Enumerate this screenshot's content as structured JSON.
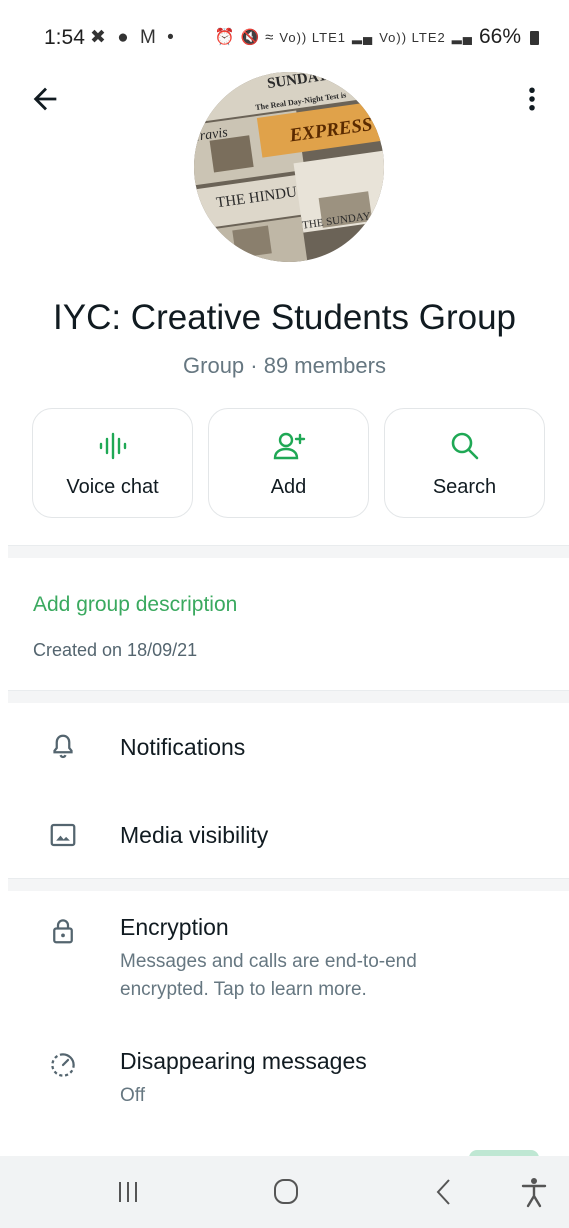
{
  "status_bar": {
    "time": "1:54",
    "left_icons": [
      "missed-call-icon",
      "chat-bubble-icon",
      "gmail-icon",
      "dot-icon"
    ],
    "network_label_1": "Vo)) LTE1",
    "network_label_2": "Vo)) LTE2",
    "battery": "66%"
  },
  "header": {
    "back_icon": "arrow-left-icon",
    "menu_icon": "more-vert-icon"
  },
  "group": {
    "title": "IYC: Creative Students Group",
    "subtitle": "Group · 89 members",
    "avatar_headlines": [
      "SUNDAY",
      "The Real Day-Night Test is",
      "Travis",
      "EXPRESS",
      "THE HINDU",
      "THE SUNDAY STAN"
    ]
  },
  "actions": [
    {
      "label": "Voice chat",
      "icon": "voice-wave-icon"
    },
    {
      "label": "Add",
      "icon": "add-person-icon"
    },
    {
      "label": "Search",
      "icon": "search-icon"
    }
  ],
  "description": {
    "add_link": "Add group description",
    "created": "Created on 18/09/21"
  },
  "settings": {
    "notifications": "Notifications",
    "media_visibility": "Media visibility",
    "encryption_title": "Encryption",
    "encryption_sub": "Messages and calls are end-to-end encrypted. Tap to learn more.",
    "disappearing_title": "Disappearing messages",
    "disappearing_sub": "Off"
  },
  "colors": {
    "accent_green": "#3aa95f",
    "icon_green": "#1fa855",
    "text_primary": "#111b21",
    "text_secondary": "#667781"
  }
}
